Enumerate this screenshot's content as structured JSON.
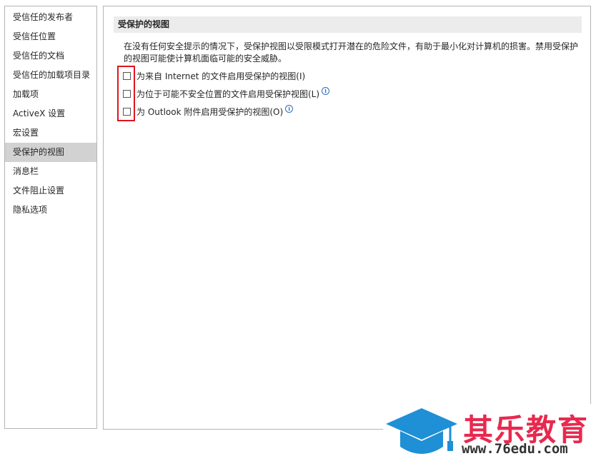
{
  "sidebar": {
    "items": [
      {
        "label": "受信任的发布者",
        "selected": false
      },
      {
        "label": "受信任位置",
        "selected": false
      },
      {
        "label": "受信任的文档",
        "selected": false
      },
      {
        "label": "受信任的加载项目录",
        "selected": false
      },
      {
        "label": "加载项",
        "selected": false
      },
      {
        "label": "ActiveX 设置",
        "selected": false
      },
      {
        "label": "宏设置",
        "selected": false
      },
      {
        "label": "受保护的视图",
        "selected": true
      },
      {
        "label": "消息栏",
        "selected": false
      },
      {
        "label": "文件阻止设置",
        "selected": false
      },
      {
        "label": "隐私选项",
        "selected": false
      }
    ]
  },
  "main": {
    "section_title": "受保护的视图",
    "description": "在没有任何安全提示的情况下，受保护视图以受限模式打开潜在的危险文件，有助于最小化对计算机的损害。禁用受保护的视图可能使计算机面临可能的安全威胁。",
    "options": [
      {
        "label": "为来自 Internet 的文件启用受保护的视图(I)",
        "checked": false,
        "info": false
      },
      {
        "label": "为位于可能不安全位置的文件启用受保护视图(L)",
        "checked": false,
        "info": true
      },
      {
        "label": "为 Outlook 附件启用受保护的视图(O)",
        "checked": false,
        "info": true
      }
    ]
  },
  "watermark": {
    "name": "其乐教育",
    "url": "www.76edu.com",
    "name_color": "#e8294f",
    "icon_color": "#1f8fd6"
  },
  "colors": {
    "highlight": "#e0141e",
    "selected_bg": "#d2d2d2",
    "header_bg": "#ececec"
  }
}
